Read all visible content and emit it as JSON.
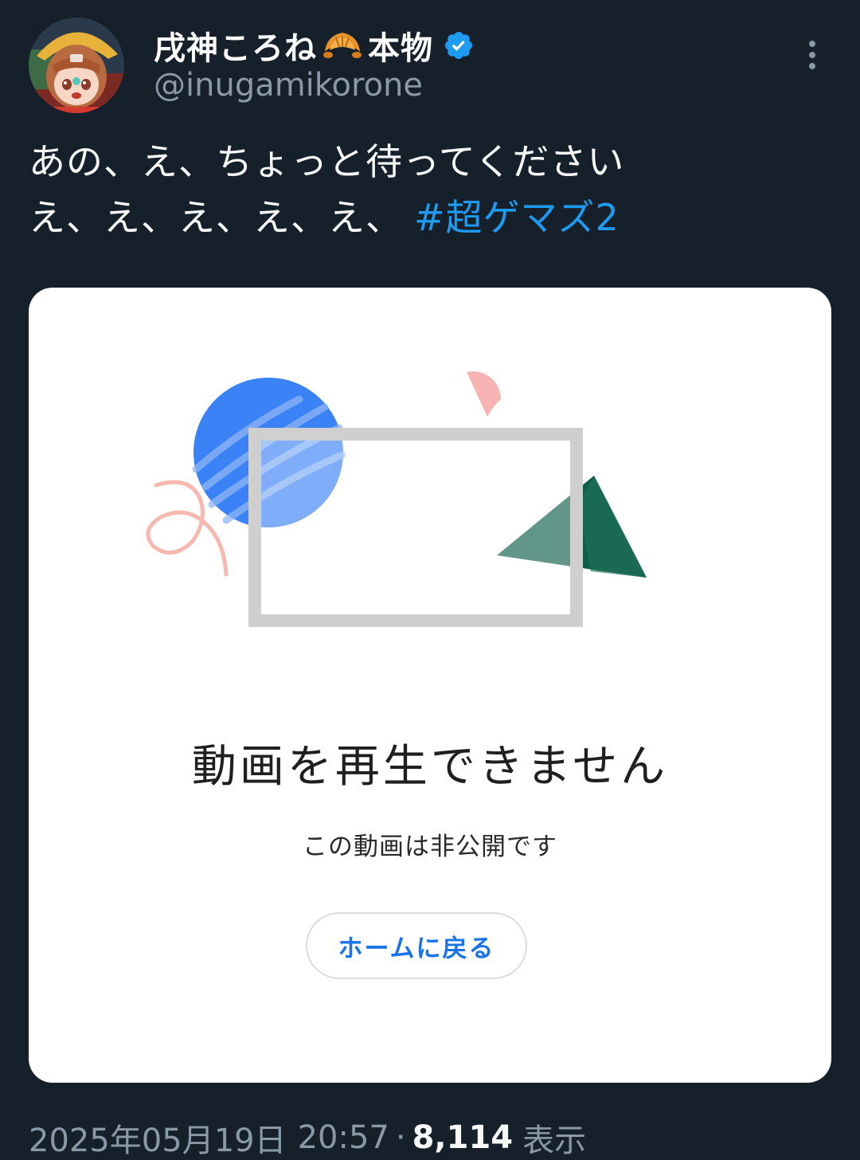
{
  "author": {
    "display_name": "戌神ころね",
    "display_name_suffix": "本物",
    "handle": "@inugamikorone",
    "verified": true,
    "avatar_icon": "avatar-image",
    "emoji_icon": "croissant-icon"
  },
  "tweet": {
    "line1": "あの、え、ちょっと待ってください",
    "line2": "え、え、え、え、え、",
    "hashtag": "#超ゲマズ2"
  },
  "media": {
    "error_title": "動画を再生できません",
    "error_subtitle": "この動画は非公開です",
    "home_button_label": "ホームに戻る"
  },
  "meta": {
    "date": "2025年05月19日",
    "time": "20:57",
    "separator": "·",
    "view_count": "8,114",
    "view_label": "表示"
  },
  "colors": {
    "background": "#15202b",
    "accent": "#1d9bf0",
    "button_text": "#1a73e8"
  }
}
